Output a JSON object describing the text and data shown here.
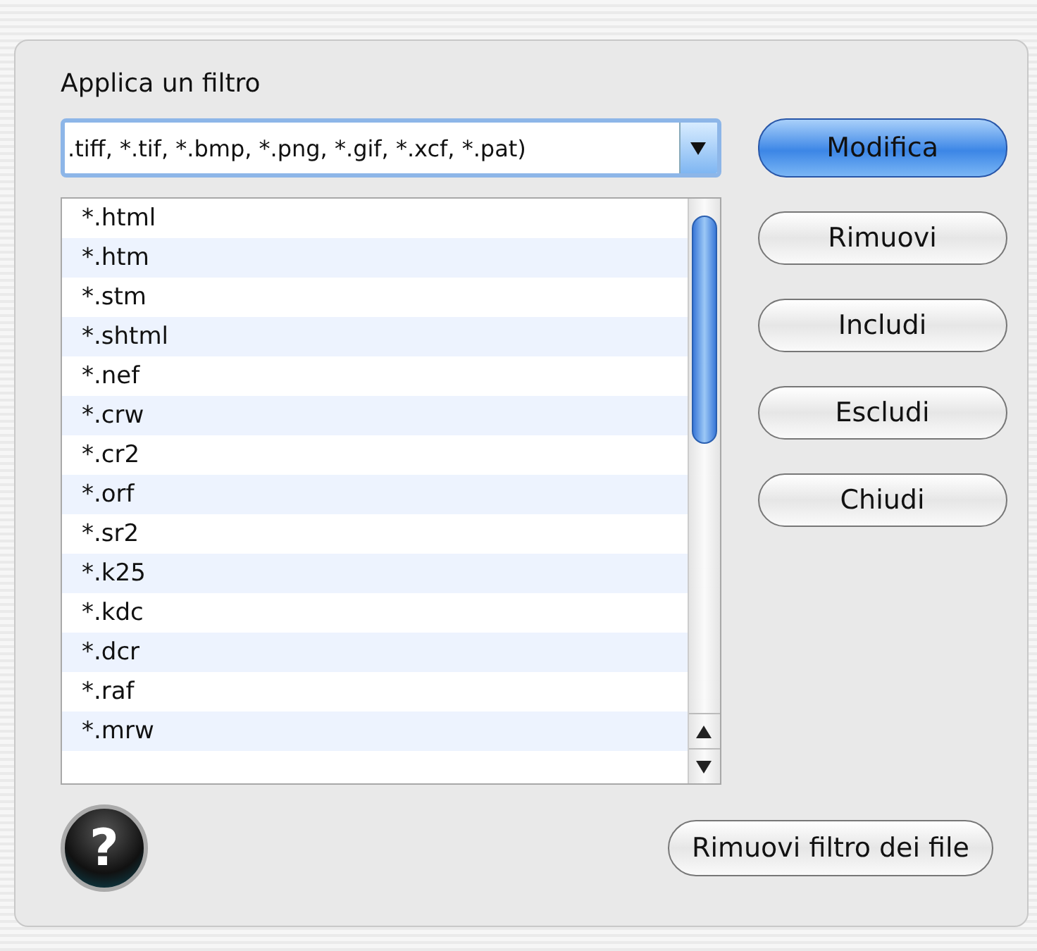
{
  "filter_label": "Applica un filtro",
  "filter_combo": {
    "value": ".tiff, *.tif, *.bmp, *.png, *.gif, *.xcf, *.pat)"
  },
  "extensions": [
    "*.html",
    "*.htm",
    "*.stm",
    "*.shtml",
    "*.nef",
    "*.crw",
    "*.cr2",
    "*.orf",
    "*.sr2",
    "*.k25",
    "*.kdc",
    "*.dcr",
    "*.raf",
    "*.mrw"
  ],
  "side_buttons": [
    {
      "label": "Modifica",
      "kind": "default"
    },
    {
      "label": "Rimuovi",
      "kind": "normal"
    },
    {
      "label": "Includi",
      "kind": "normal"
    },
    {
      "label": "Escludi",
      "kind": "normal"
    },
    {
      "label": "Chiudi",
      "kind": "normal"
    }
  ],
  "help_button": {
    "label": "?"
  },
  "remove_filter_button": {
    "label": "Rimuovi filtro dei file"
  }
}
